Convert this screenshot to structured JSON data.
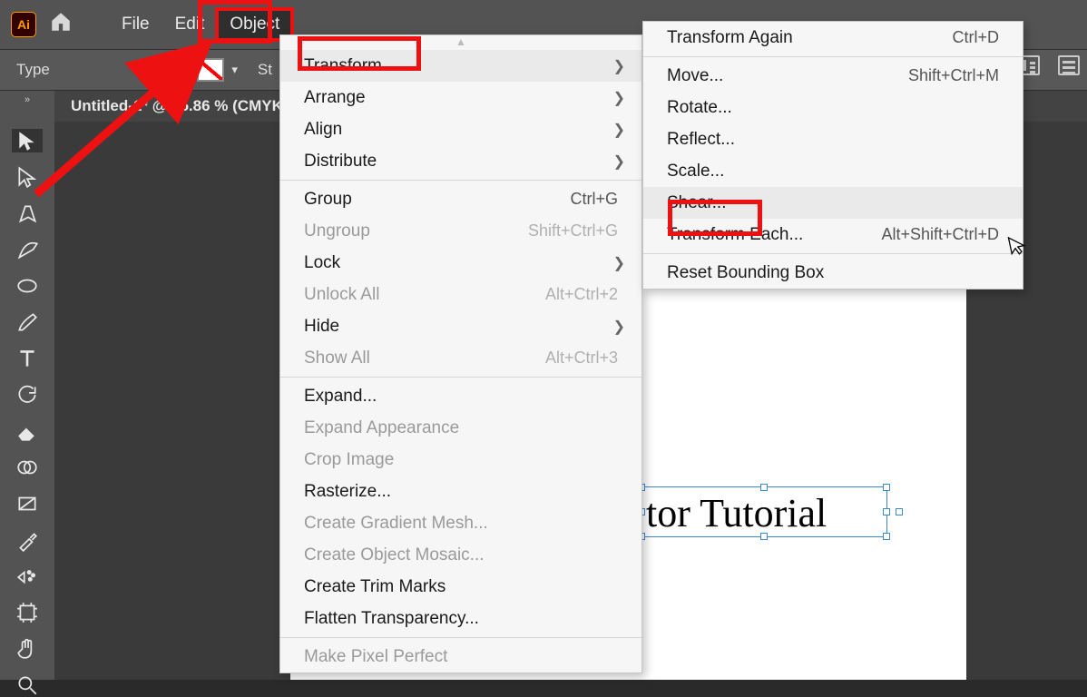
{
  "app": {
    "logo": "Ai"
  },
  "menubar": {
    "file": "File",
    "edit": "Edit",
    "object": "Object"
  },
  "options": {
    "type_label": "Type",
    "stroke_label": "St"
  },
  "tab": {
    "title": "Untitled-1* @ 45.86 % (CMYK"
  },
  "canvas": {
    "text": "tor Tutorial"
  },
  "object_menu": {
    "transform": "Transform",
    "arrange": "Arrange",
    "align": "Align",
    "distribute": "Distribute",
    "group": "Group",
    "group_sc": "Ctrl+G",
    "ungroup": "Ungroup",
    "ungroup_sc": "Shift+Ctrl+G",
    "lock": "Lock",
    "unlock": "Unlock All",
    "unlock_sc": "Alt+Ctrl+2",
    "hide": "Hide",
    "show": "Show All",
    "show_sc": "Alt+Ctrl+3",
    "expand": "Expand...",
    "expand_app": "Expand Appearance",
    "crop": "Crop Image",
    "raster": "Rasterize...",
    "grad": "Create Gradient Mesh...",
    "mosaic": "Create Object Mosaic...",
    "trim": "Create Trim Marks",
    "flatten": "Flatten Transparency...",
    "pixel": "Make Pixel Perfect"
  },
  "transform_menu": {
    "again": "Transform Again",
    "again_sc": "Ctrl+D",
    "move": "Move...",
    "move_sc": "Shift+Ctrl+M",
    "rotate": "Rotate...",
    "reflect": "Reflect...",
    "scale": "Scale...",
    "shear": "Shear...",
    "each": "Transform Each...",
    "each_sc": "Alt+Shift+Ctrl+D",
    "reset": "Reset Bounding Box"
  }
}
